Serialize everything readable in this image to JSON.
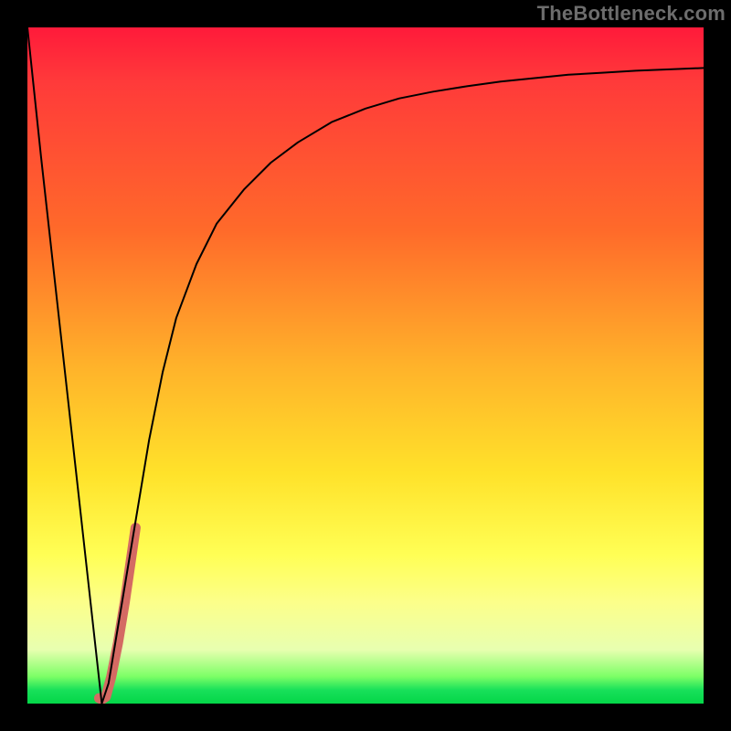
{
  "watermark": "TheBottleneck.com",
  "chart_data": {
    "type": "line",
    "title": "",
    "xlabel": "",
    "ylabel": "",
    "xlim": [
      0,
      100
    ],
    "ylim": [
      0,
      100
    ],
    "series": [
      {
        "name": "bottleneck-curve",
        "color": "#000000",
        "stroke_width": 2,
        "x": [
          0,
          2,
          4,
          6,
          8,
          10,
          11,
          12,
          14,
          16,
          18,
          20,
          22,
          25,
          28,
          32,
          36,
          40,
          45,
          50,
          55,
          60,
          65,
          70,
          75,
          80,
          85,
          90,
          95,
          100
        ],
        "y": [
          100,
          81,
          63,
          45,
          27,
          9,
          0,
          3,
          15,
          27,
          39,
          49,
          57,
          65,
          71,
          76,
          80,
          83,
          86,
          88,
          89.5,
          90.5,
          91.3,
          92,
          92.5,
          93,
          93.3,
          93.6,
          93.8,
          94
        ]
      },
      {
        "name": "highlight-segment",
        "color": "#d46a63",
        "stroke_width": 11,
        "linecap": "round",
        "x": [
          10.6,
          11.0,
          11.6,
          12.4,
          13.4,
          14.4,
          15.2,
          16.0
        ],
        "y": [
          0.8,
          0.6,
          1.0,
          4.0,
          9.0,
          15.0,
          20.5,
          26.0
        ]
      }
    ],
    "gradient_stops": [
      {
        "pos": 0,
        "color": "#ff1a3a"
      },
      {
        "pos": 8,
        "color": "#ff3a3a"
      },
      {
        "pos": 30,
        "color": "#ff6a2a"
      },
      {
        "pos": 50,
        "color": "#ffb22a"
      },
      {
        "pos": 66,
        "color": "#ffe22a"
      },
      {
        "pos": 78,
        "color": "#ffff55"
      },
      {
        "pos": 85,
        "color": "#fcff8a"
      },
      {
        "pos": 92,
        "color": "#e8ffb0"
      },
      {
        "pos": 96,
        "color": "#7cff66"
      },
      {
        "pos": 98,
        "color": "#18e05a"
      },
      {
        "pos": 100,
        "color": "#04d648"
      }
    ]
  }
}
